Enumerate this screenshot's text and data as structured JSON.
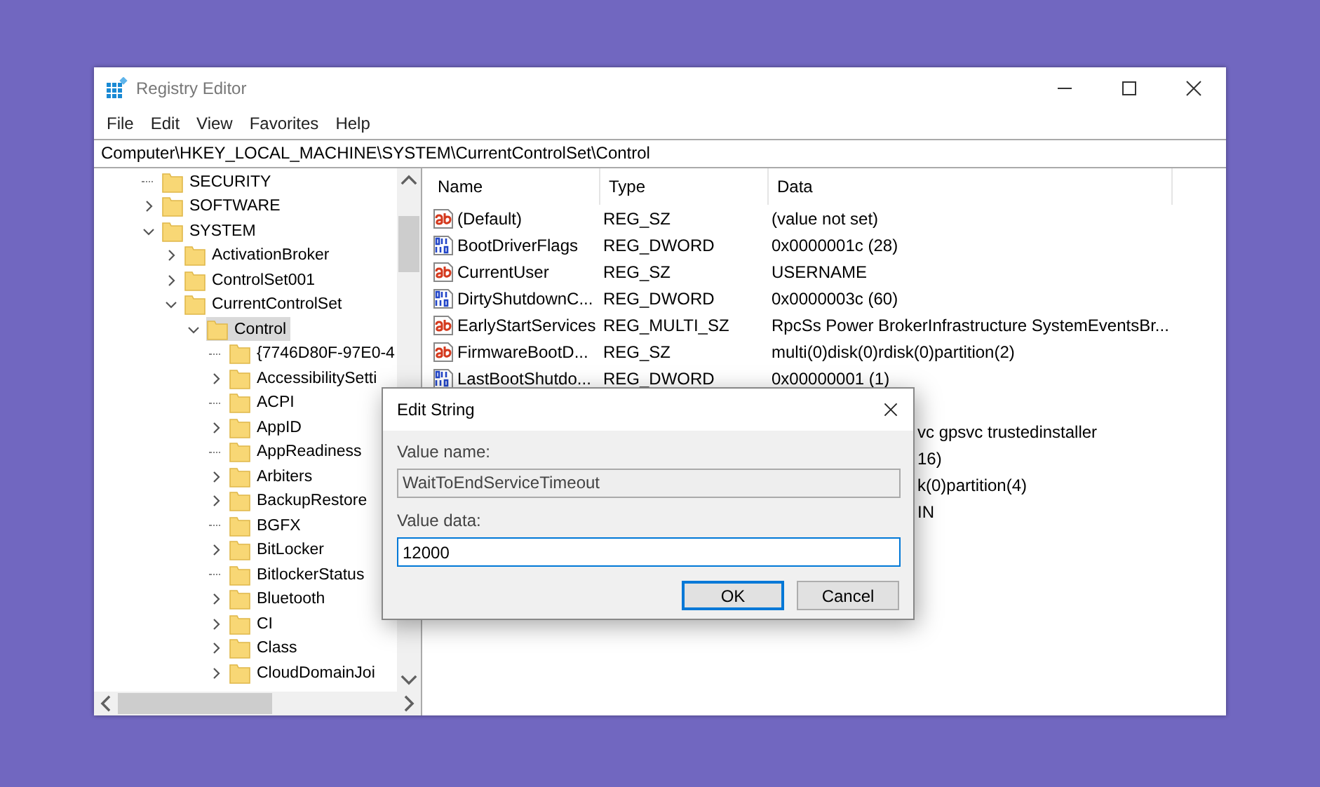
{
  "window": {
    "title": "Registry Editor"
  },
  "menu": [
    "File",
    "Edit",
    "View",
    "Favorites",
    "Help"
  ],
  "address": "Computer\\HKEY_LOCAL_MACHINE\\SYSTEM\\CurrentControlSet\\Control",
  "tree": [
    {
      "label": "SECURITY",
      "expandable": false,
      "selected": false
    },
    {
      "label": "SOFTWARE",
      "expandable": true,
      "expanded": false,
      "selected": false
    },
    {
      "label": "SYSTEM",
      "expandable": true,
      "expanded": true,
      "selected": false,
      "children": [
        {
          "label": "ActivationBroker",
          "expandable": true,
          "expanded": false,
          "selected": false
        },
        {
          "label": "ControlSet001",
          "expandable": true,
          "expanded": false,
          "selected": false
        },
        {
          "label": "CurrentControlSet",
          "expandable": true,
          "expanded": true,
          "selected": false,
          "children": [
            {
              "label": "Control",
              "expandable": true,
              "expanded": true,
              "selected": true,
              "children": [
                {
                  "label": "{7746D80F-97E0-4",
                  "expandable": false,
                  "selected": false
                },
                {
                  "label": "AccessibilitySetti",
                  "expandable": true,
                  "expanded": false,
                  "selected": false
                },
                {
                  "label": "ACPI",
                  "expandable": false,
                  "selected": false
                },
                {
                  "label": "AppID",
                  "expandable": true,
                  "expanded": false,
                  "selected": false
                },
                {
                  "label": "AppReadiness",
                  "expandable": false,
                  "selected": false
                },
                {
                  "label": "Arbiters",
                  "expandable": true,
                  "expanded": false,
                  "selected": false
                },
                {
                  "label": "BackupRestore",
                  "expandable": true,
                  "expanded": false,
                  "selected": false
                },
                {
                  "label": "BGFX",
                  "expandable": false,
                  "selected": false
                },
                {
                  "label": "BitLocker",
                  "expandable": true,
                  "expanded": false,
                  "selected": false
                },
                {
                  "label": "BitlockerStatus",
                  "expandable": false,
                  "selected": false
                },
                {
                  "label": "Bluetooth",
                  "expandable": true,
                  "expanded": false,
                  "selected": false
                },
                {
                  "label": "CI",
                  "expandable": true,
                  "expanded": false,
                  "selected": false
                },
                {
                  "label": "Class",
                  "expandable": true,
                  "expanded": false,
                  "selected": false
                },
                {
                  "label": "CloudDomainJoi",
                  "expandable": true,
                  "expanded": false,
                  "selected": false
                }
              ]
            }
          ]
        }
      ]
    }
  ],
  "columns": [
    "Name",
    "Type",
    "Data"
  ],
  "values": [
    {
      "kind": "string",
      "name": "(Default)",
      "type": "REG_SZ",
      "data": "(value not set)"
    },
    {
      "kind": "binary",
      "name": "BootDriverFlags",
      "type": "REG_DWORD",
      "data": "0x0000001c (28)"
    },
    {
      "kind": "string",
      "name": "CurrentUser",
      "type": "REG_SZ",
      "data": "USERNAME"
    },
    {
      "kind": "binary",
      "name": "DirtyShutdownC...",
      "type": "REG_DWORD",
      "data": "0x0000003c (60)"
    },
    {
      "kind": "string",
      "name": "EarlyStartServices",
      "type": "REG_MULTI_SZ",
      "data": "RpcSs Power BrokerInfrastructure SystemEventsBr..."
    },
    {
      "kind": "string",
      "name": "FirmwareBootD...",
      "type": "REG_SZ",
      "data": "multi(0)disk(0)rdisk(0)partition(2)"
    },
    {
      "kind": "binary",
      "name": "LastBootShutdo...",
      "type": "REG_DWORD",
      "data": "0x00000001 (1)"
    },
    {
      "kind": "covered"
    },
    {
      "kind": "covered",
      "data": "vc gpsvc trustedinstaller"
    },
    {
      "kind": "covered",
      "data": "16)"
    },
    {
      "kind": "covered",
      "data": "k(0)partition(4)"
    },
    {
      "kind": "covered",
      "data": "IN"
    }
  ],
  "dialog": {
    "title": "Edit String",
    "name_label": "Value name:",
    "name_value": "WaitToEndServiceTimeout",
    "data_label": "Value data:",
    "data_value": "12000",
    "buttons": [
      {
        "label": "OK",
        "default": true
      },
      {
        "label": "Cancel",
        "default": false
      }
    ]
  }
}
